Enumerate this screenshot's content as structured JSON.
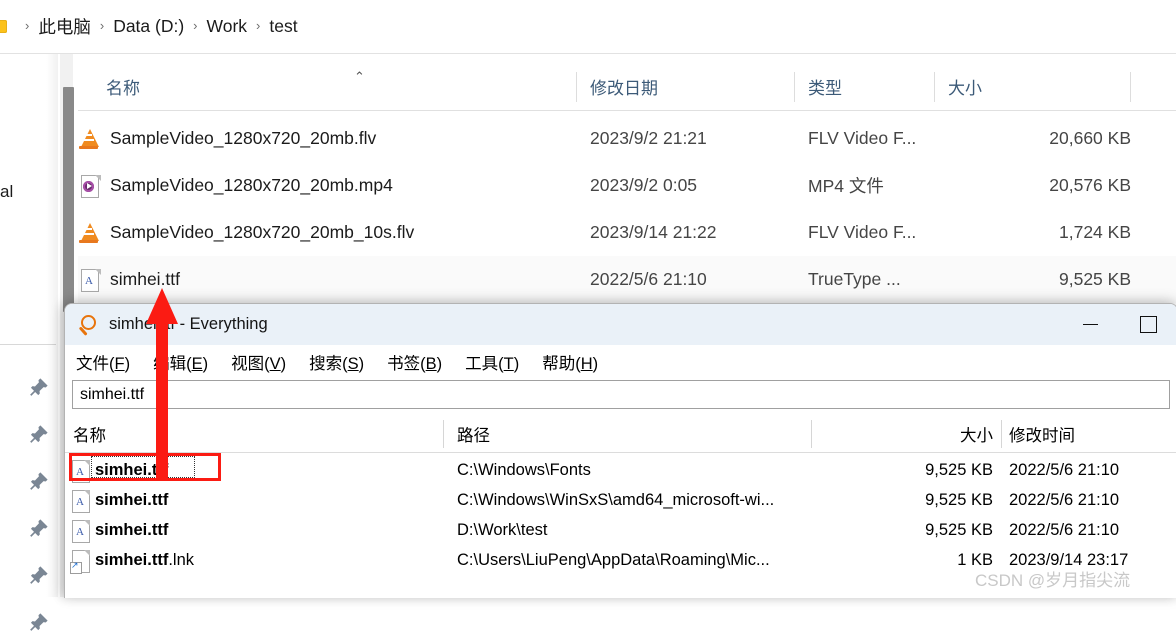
{
  "explorer": {
    "breadcrumb": {
      "folder_icon": "folder-icon",
      "items": [
        "此电脑",
        "Data (D:)",
        "Work",
        "test"
      ],
      "separator": "›"
    },
    "nav_pane": {
      "truncated_label": "al",
      "pin_icon": "pin-icon",
      "pin_count": 6
    },
    "columns": [
      {
        "key": "name",
        "label": "名称"
      },
      {
        "key": "date",
        "label": "修改日期"
      },
      {
        "key": "type",
        "label": "类型"
      },
      {
        "key": "size",
        "label": "大小"
      }
    ],
    "sort_glyph": "⌃",
    "rows": [
      {
        "icon": "vlc-cone-icon",
        "name": "SampleVideo_1280x720_20mb.flv",
        "date": "2023/9/2 21:21",
        "type": "FLV Video F...",
        "size": "20,660 KB"
      },
      {
        "icon": "mp4-file-icon",
        "name": "SampleVideo_1280x720_20mb.mp4",
        "date": "2023/9/2 0:05",
        "type": "MP4 文件",
        "size": "20,576 KB"
      },
      {
        "icon": "vlc-cone-icon",
        "name": "SampleVideo_1280x720_20mb_10s.flv",
        "date": "2023/9/14 21:22",
        "type": "FLV Video F...",
        "size": "1,724 KB"
      },
      {
        "icon": "truetype-font-icon",
        "name": "simhei.ttf",
        "date": "2022/5/6 21:10",
        "type": "TrueType ...",
        "size": "9,525 KB"
      }
    ]
  },
  "everything": {
    "title_icon": "magnifier-icon",
    "title": "simhei.ttf - Everything",
    "window_controls": {
      "minimize": "minimize-icon",
      "maximize": "maximize-icon"
    },
    "menu": [
      {
        "label": "文件(",
        "key": "F",
        "close": ")"
      },
      {
        "label": "编辑(",
        "key": "E",
        "close": ")"
      },
      {
        "label": "视图(",
        "key": "V",
        "close": ")"
      },
      {
        "label": "搜索(",
        "key": "S",
        "close": ")"
      },
      {
        "label": "书签(",
        "key": "B",
        "close": ")"
      },
      {
        "label": "工具(",
        "key": "T",
        "close": ")"
      },
      {
        "label": "帮助(",
        "key": "H",
        "close": ")"
      }
    ],
    "search": {
      "value": "simhei.ttf",
      "placeholder": ""
    },
    "columns": [
      {
        "key": "name",
        "label": "名称"
      },
      {
        "key": "path",
        "label": "路径"
      },
      {
        "key": "size",
        "label": "大小"
      },
      {
        "key": "date",
        "label": "修改时间"
      }
    ],
    "rows": [
      {
        "icon": "truetype-font-icon",
        "name": "simhei.ttf",
        "name_ext": "",
        "path": "C:\\Windows\\Fonts",
        "size": "9,525 KB",
        "date": "2022/5/6 21:10",
        "selected": true
      },
      {
        "icon": "truetype-font-icon",
        "name": "simhei.ttf",
        "name_ext": "",
        "path": "C:\\Windows\\WinSxS\\amd64_microsoft-wi...",
        "size": "9,525 KB",
        "date": "2022/5/6 21:10",
        "selected": false
      },
      {
        "icon": "truetype-font-icon",
        "name": "simhei.ttf",
        "name_ext": "",
        "path": "D:\\Work\\test",
        "size": "9,525 KB",
        "date": "2022/5/6 21:10",
        "selected": false
      },
      {
        "icon": "shortcut-font-icon",
        "name": "simhei.ttf",
        "name_ext": ".lnk",
        "path": "C:\\Users\\LiuPeng\\AppData\\Roaming\\Mic...",
        "size": "1 KB",
        "date": "2023/9/14 23:17",
        "selected": false
      }
    ]
  },
  "annotation": {
    "arrow": "red-up-arrow",
    "arrow_color": "#fb1b13",
    "highlight_color": "#fb1b13"
  },
  "watermark": {
    "text": "CSDN @岁月指尖流",
    "color": "#c8c8c8"
  }
}
